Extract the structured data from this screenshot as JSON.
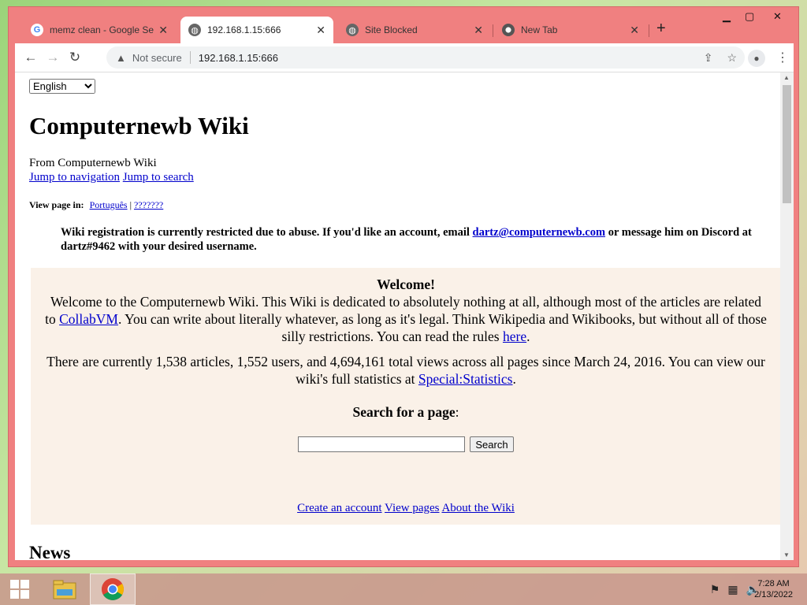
{
  "browser": {
    "tabs": [
      {
        "title": "memz clean - Google Sea",
        "icon": "google-icon"
      },
      {
        "title": "192.168.1.15:666",
        "icon": "globe-icon"
      },
      {
        "title": "Site Blocked",
        "icon": "globe-icon"
      },
      {
        "title": "New Tab",
        "icon": "chrome-icon"
      }
    ],
    "security_label": "Not secure",
    "url": "192.168.1.15:666"
  },
  "page": {
    "language": "English",
    "title": "Computernewb Wiki",
    "from": "From Computernewb Wiki",
    "jump_nav": "Jump to navigation",
    "jump_search": "Jump to search",
    "view_page_in": "View page in:",
    "lang_links": [
      "Português",
      "???????"
    ],
    "notice_a": "Wiki registration is currently restricted due to abuse. If you'd like an account, email ",
    "notice_email": "dartz@computernewb.com",
    "notice_b": " or message him on Discord at dartz#9462 with your desired username.",
    "welcome_title": "Welcome!",
    "welcome_a": "Welcome to the Computernewb Wiki. This Wiki is dedicated to absolutely nothing at all, although most of the articles are related to ",
    "welcome_link": "CollabVM",
    "welcome_b": ". You can write about literally whatever, as long as it's legal. Think Wikipedia and Wikibooks, but without all of those silly restrictions. You can read the rules ",
    "welcome_here": "here",
    "welcome_c": ".",
    "stats_a": "There are currently 1,538 articles, 1,552 users, and 4,694,161 total views across all pages since March 24, 2016. You can view our wiki's full statistics at ",
    "stats_link": "Special:Statistics",
    "stats_b": ".",
    "search_heading": "Search for a page",
    "search_colon": ":",
    "search_button": "Search",
    "link_create": "Create an account",
    "link_view": "View pages",
    "link_about": "About the Wiki",
    "news": "News"
  },
  "taskbar": {
    "time": "7:28 AM",
    "date": "2/13/2022"
  }
}
